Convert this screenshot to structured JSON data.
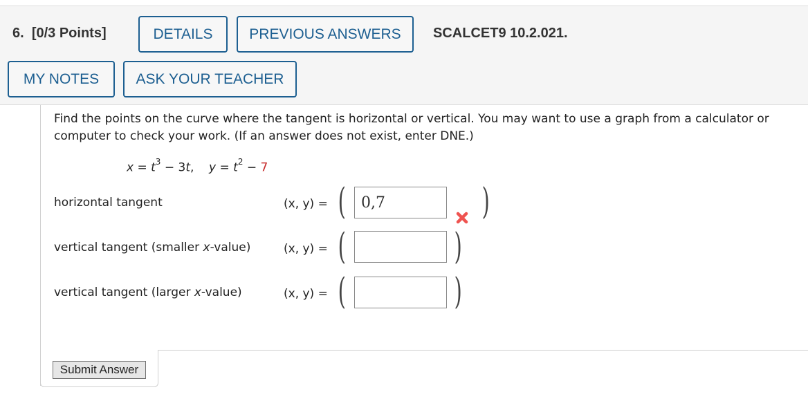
{
  "header": {
    "question_number": "6.",
    "points": "[0/3 Points]",
    "buttons": {
      "details": "DETAILS",
      "previous_answers": "PREVIOUS ANSWERS",
      "my_notes": "MY NOTES",
      "ask_teacher": "ASK YOUR TEACHER"
    },
    "problem_code": "SCALCET9 10.2.021."
  },
  "question": {
    "prompt_line1": "Find the points on the curve where the tangent is horizontal or vertical. You may want to use a graph from a calculator or",
    "prompt_line2": "computer to check your work. (If an answer does not exist, enter DNE.)",
    "equation": {
      "x_lhs": "x",
      "x_rhs_base": "t",
      "x_rhs_exp": "3",
      "x_rhs_rest": " − 3",
      "x_rhs_var": "t",
      "y_lhs": "y",
      "y_rhs_base": "t",
      "y_rhs_exp": "2",
      "y_rhs_minus": " − ",
      "y_rhs_const": "7"
    }
  },
  "answers": [
    {
      "label_pre": "horizontal tangent",
      "label_var": "",
      "label_post": "",
      "xy_label": "(x, y)  =",
      "value": "0,7",
      "status": "incorrect"
    },
    {
      "label_pre": "vertical tangent (smaller ",
      "label_var": "x",
      "label_post": "-value)",
      "xy_label": "(x, y)  =",
      "value": "",
      "status": ""
    },
    {
      "label_pre": "vertical tangent (larger ",
      "label_var": "x",
      "label_post": "-value)",
      "xy_label": "(x, y)  =",
      "value": "",
      "status": ""
    }
  ],
  "submit_label": "Submit Answer",
  "colors": {
    "accent": "#1d5f91",
    "error": "#e53935",
    "highlight_red": "#c62828"
  }
}
